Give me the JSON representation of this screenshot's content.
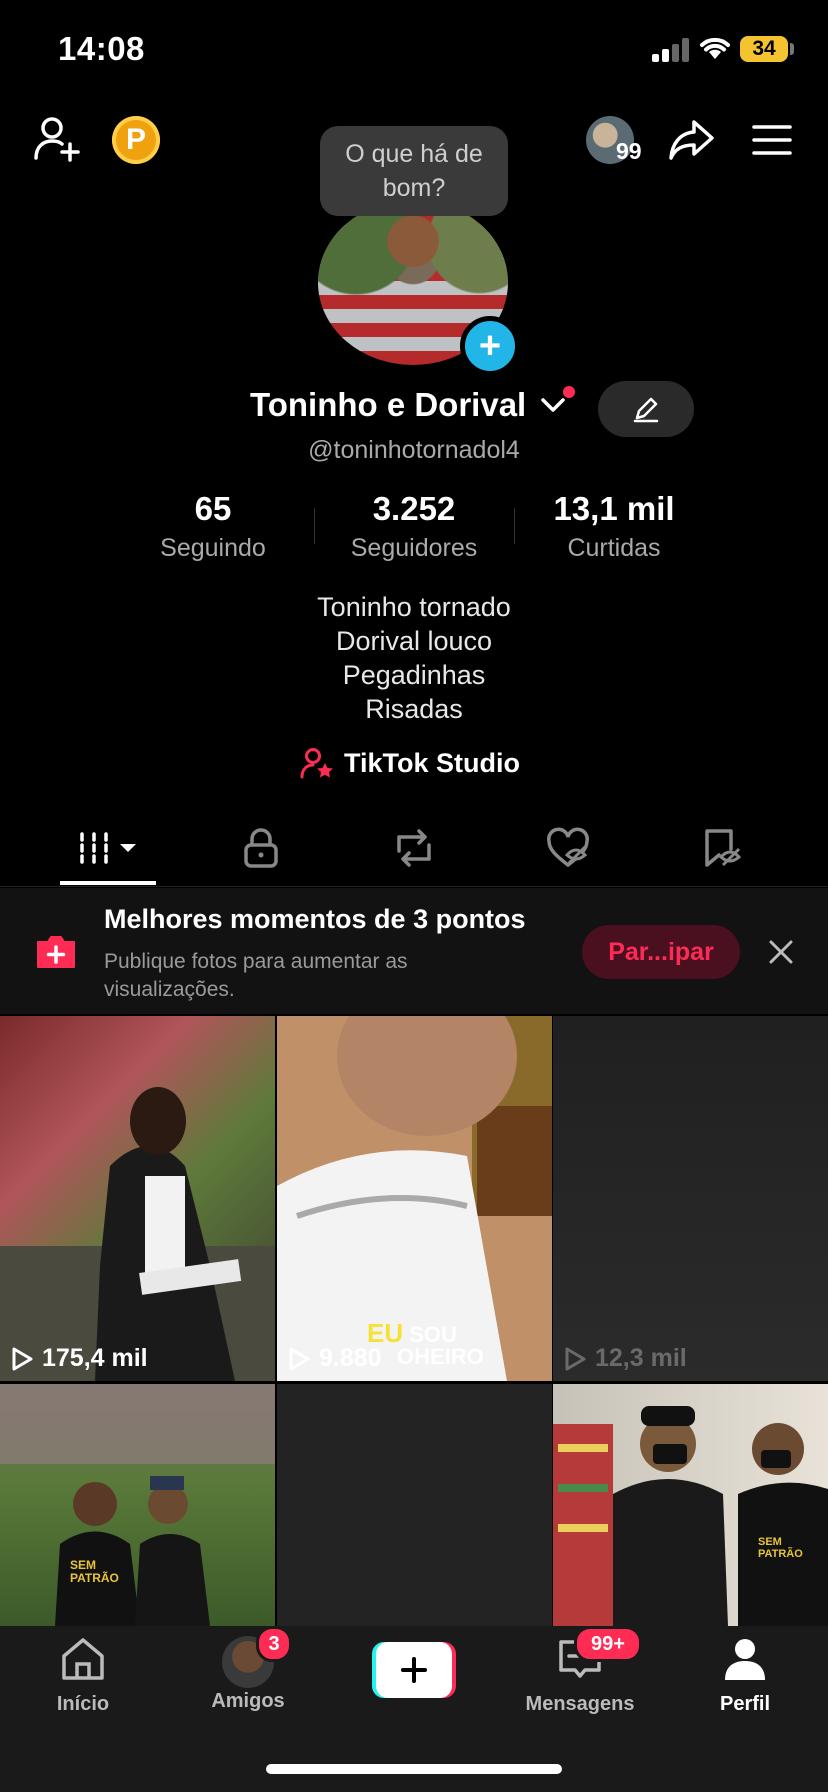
{
  "status_bar": {
    "time": "14:08",
    "battery": "34"
  },
  "top_bar": {
    "coin_letter": "P",
    "notif_count": "99"
  },
  "tooltip": {
    "text": "O que há de bom?"
  },
  "profile": {
    "name": "Toninho e Dorival",
    "handle": "@toninhotornadol4",
    "stats": [
      {
        "value": "65",
        "label": "Seguindo"
      },
      {
        "value": "3.252",
        "label": "Seguidores"
      },
      {
        "value": "13,1 mil",
        "label": "Curtidas"
      }
    ],
    "bio": [
      "Toninho tornado",
      "Dorival louco",
      "Pegadinhas",
      "Risadas"
    ],
    "studio_label": "TikTok Studio"
  },
  "banner": {
    "title": "Melhores momentos de 3 pontos",
    "subtitle": "Publique fotos para aumentar as visualizações.",
    "button": "Par...ipar"
  },
  "videos": [
    {
      "views": "175,4 mil"
    },
    {
      "views": "9.880",
      "caption_a": "EU",
      "caption_b": "SOU",
      "caption_c": "OHEIRO"
    },
    {
      "views": "12,3 mil"
    },
    {
      "shirt_text": "SEM PATRÃO"
    },
    {},
    {
      "shirt_text": "SEM PATRÃO"
    }
  ],
  "bottom_nav": {
    "items": [
      {
        "label": "Início"
      },
      {
        "label": "Amigos",
        "badge": "3"
      },
      {
        "label": ""
      },
      {
        "label": "Mensagens",
        "badge": "99+"
      },
      {
        "label": "Perfil"
      }
    ]
  },
  "colors": {
    "accent": "#fe2c55",
    "cyan": "#22b6e8",
    "coin": "#f0a10e"
  }
}
